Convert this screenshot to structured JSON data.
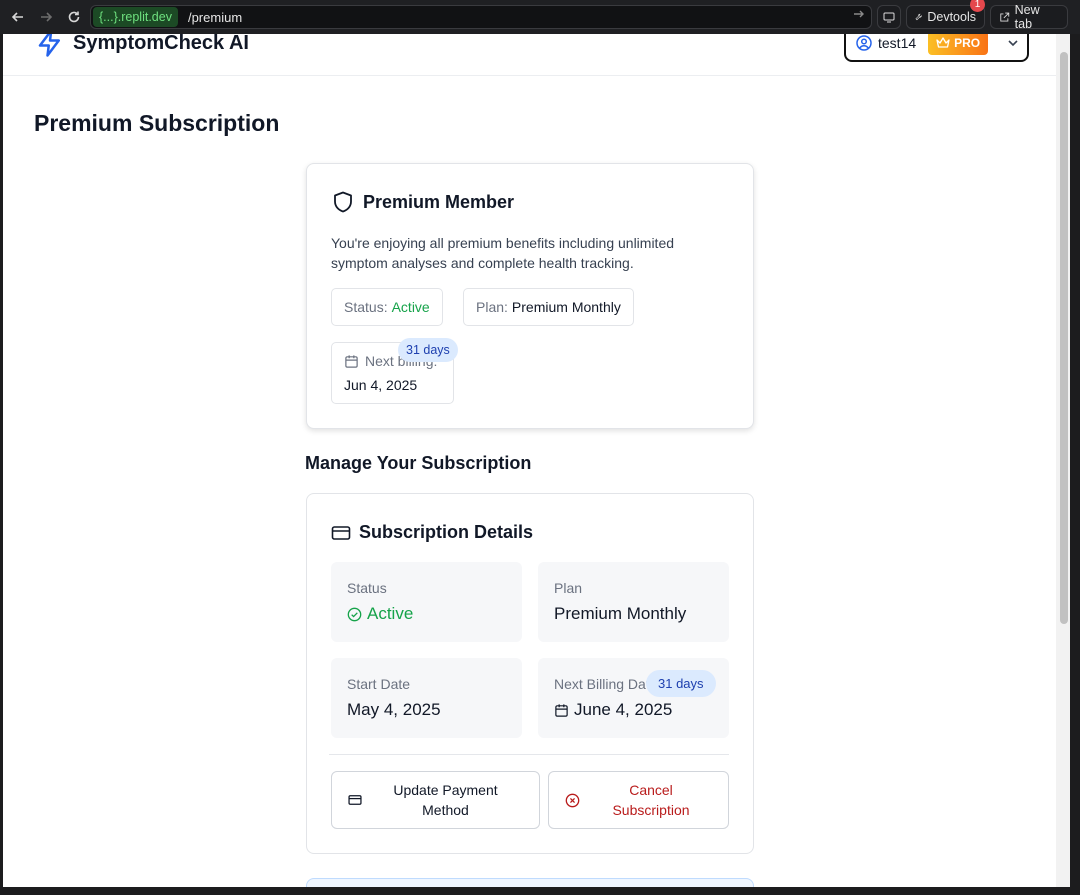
{
  "browser": {
    "url_host": "{...}.replit.dev",
    "url_path": "/premium",
    "devtools_label": "Devtools",
    "devtools_badge": "1",
    "new_tab_label": "New tab"
  },
  "header": {
    "app_name": "SymptomCheck AI",
    "username": "test14",
    "pro_label": "PRO",
    "brand_color": "#2563eb"
  },
  "page": {
    "title": "Premium Subscription"
  },
  "premium_card": {
    "title": "Premium Member",
    "description": "You're enjoying all premium benefits including unlimited symptom analyses and complete health tracking.",
    "status_label": "Status:",
    "status_value": "Active",
    "plan_label": "Plan:",
    "plan_value": "Premium Monthly",
    "next_billing_label": "Next billing:",
    "next_billing_date": "Jun 4, 2025",
    "days_left": "31 days"
  },
  "manage": {
    "section_title": "Manage Your Subscription",
    "card_title": "Subscription Details",
    "status_label": "Status",
    "status_value": "Active",
    "plan_label": "Plan",
    "plan_value": "Premium Monthly",
    "start_label": "Start Date",
    "start_value": "May 4, 2025",
    "next_label": "Next Billing Date",
    "next_value": "June 4, 2025",
    "days_left": "31 days",
    "update_button": "Update Payment Method",
    "cancel_button": "Cancel Subscription"
  }
}
